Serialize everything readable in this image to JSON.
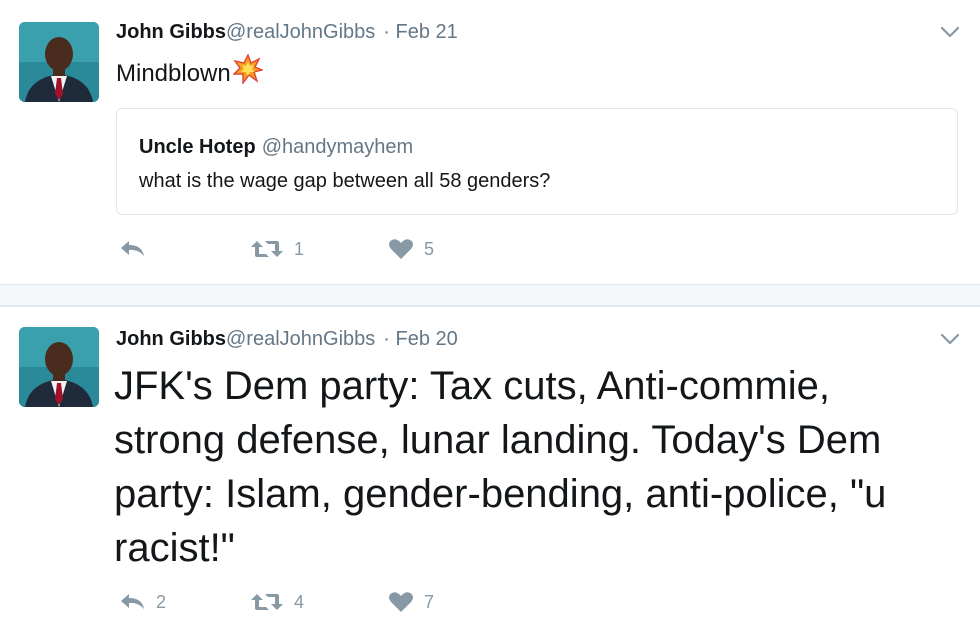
{
  "tweets": [
    {
      "author_name": "John Gibbs",
      "author_handle": "@realJohnGibbs",
      "date": "Feb 21",
      "text": "Mindblown",
      "emoji_icon": "collision-icon",
      "quoted": {
        "author_name": "Uncle Hotep",
        "author_handle": "@handymayhem",
        "text": "what is the wage gap between all 58 genders?"
      },
      "actions": {
        "reply_count": "",
        "retweet_count": "1",
        "like_count": "5"
      }
    },
    {
      "author_name": "John Gibbs",
      "author_handle": "@realJohnGibbs",
      "date": "Feb 20",
      "text": "JFK's Dem party: Tax cuts, Anti-commie, strong defense, lunar landing. Today's Dem party: Islam, gender-bending, anti-police, \"u racist!\"",
      "actions": {
        "reply_count": "2",
        "retweet_count": "4",
        "like_count": "7"
      }
    }
  ],
  "colors": {
    "text": "#14171a",
    "muted": "#657786",
    "icon": "#8899a6",
    "border": "#e1e8ed"
  }
}
